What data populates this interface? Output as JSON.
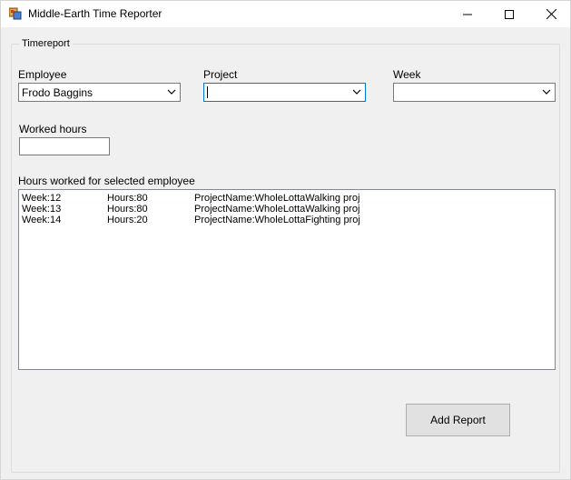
{
  "window": {
    "title": "Middle-Earth Time Reporter"
  },
  "group": {
    "legend": "Timereport"
  },
  "employee": {
    "label": "Employee",
    "value": "Frodo Baggins"
  },
  "project": {
    "label": "Project",
    "value": ""
  },
  "week": {
    "label": "Week",
    "value": ""
  },
  "worked_hours": {
    "label": "Worked hours",
    "value": ""
  },
  "hours_list": {
    "label": "Hours worked for selected employee",
    "rows": [
      {
        "week": "Week:12",
        "hours": "Hours:80",
        "project": "ProjectName:WholeLottaWalking proj"
      },
      {
        "week": "Week:13",
        "hours": "Hours:80",
        "project": "ProjectName:WholeLottaWalking proj"
      },
      {
        "week": "Week:14",
        "hours": "Hours:20",
        "project": "ProjectName:WholeLottaFighting proj"
      }
    ]
  },
  "actions": {
    "add_report_label": "Add Report"
  },
  "icons": {
    "app": "app-icon",
    "minimize": "minimize-icon",
    "maximize": "maximize-icon",
    "close": "close-icon",
    "dropdown": "chevron-down-icon"
  },
  "colors": {
    "focus_border": "#0078d7",
    "window_bg": "#f0f0f0",
    "button_bg": "#e1e1e1"
  }
}
